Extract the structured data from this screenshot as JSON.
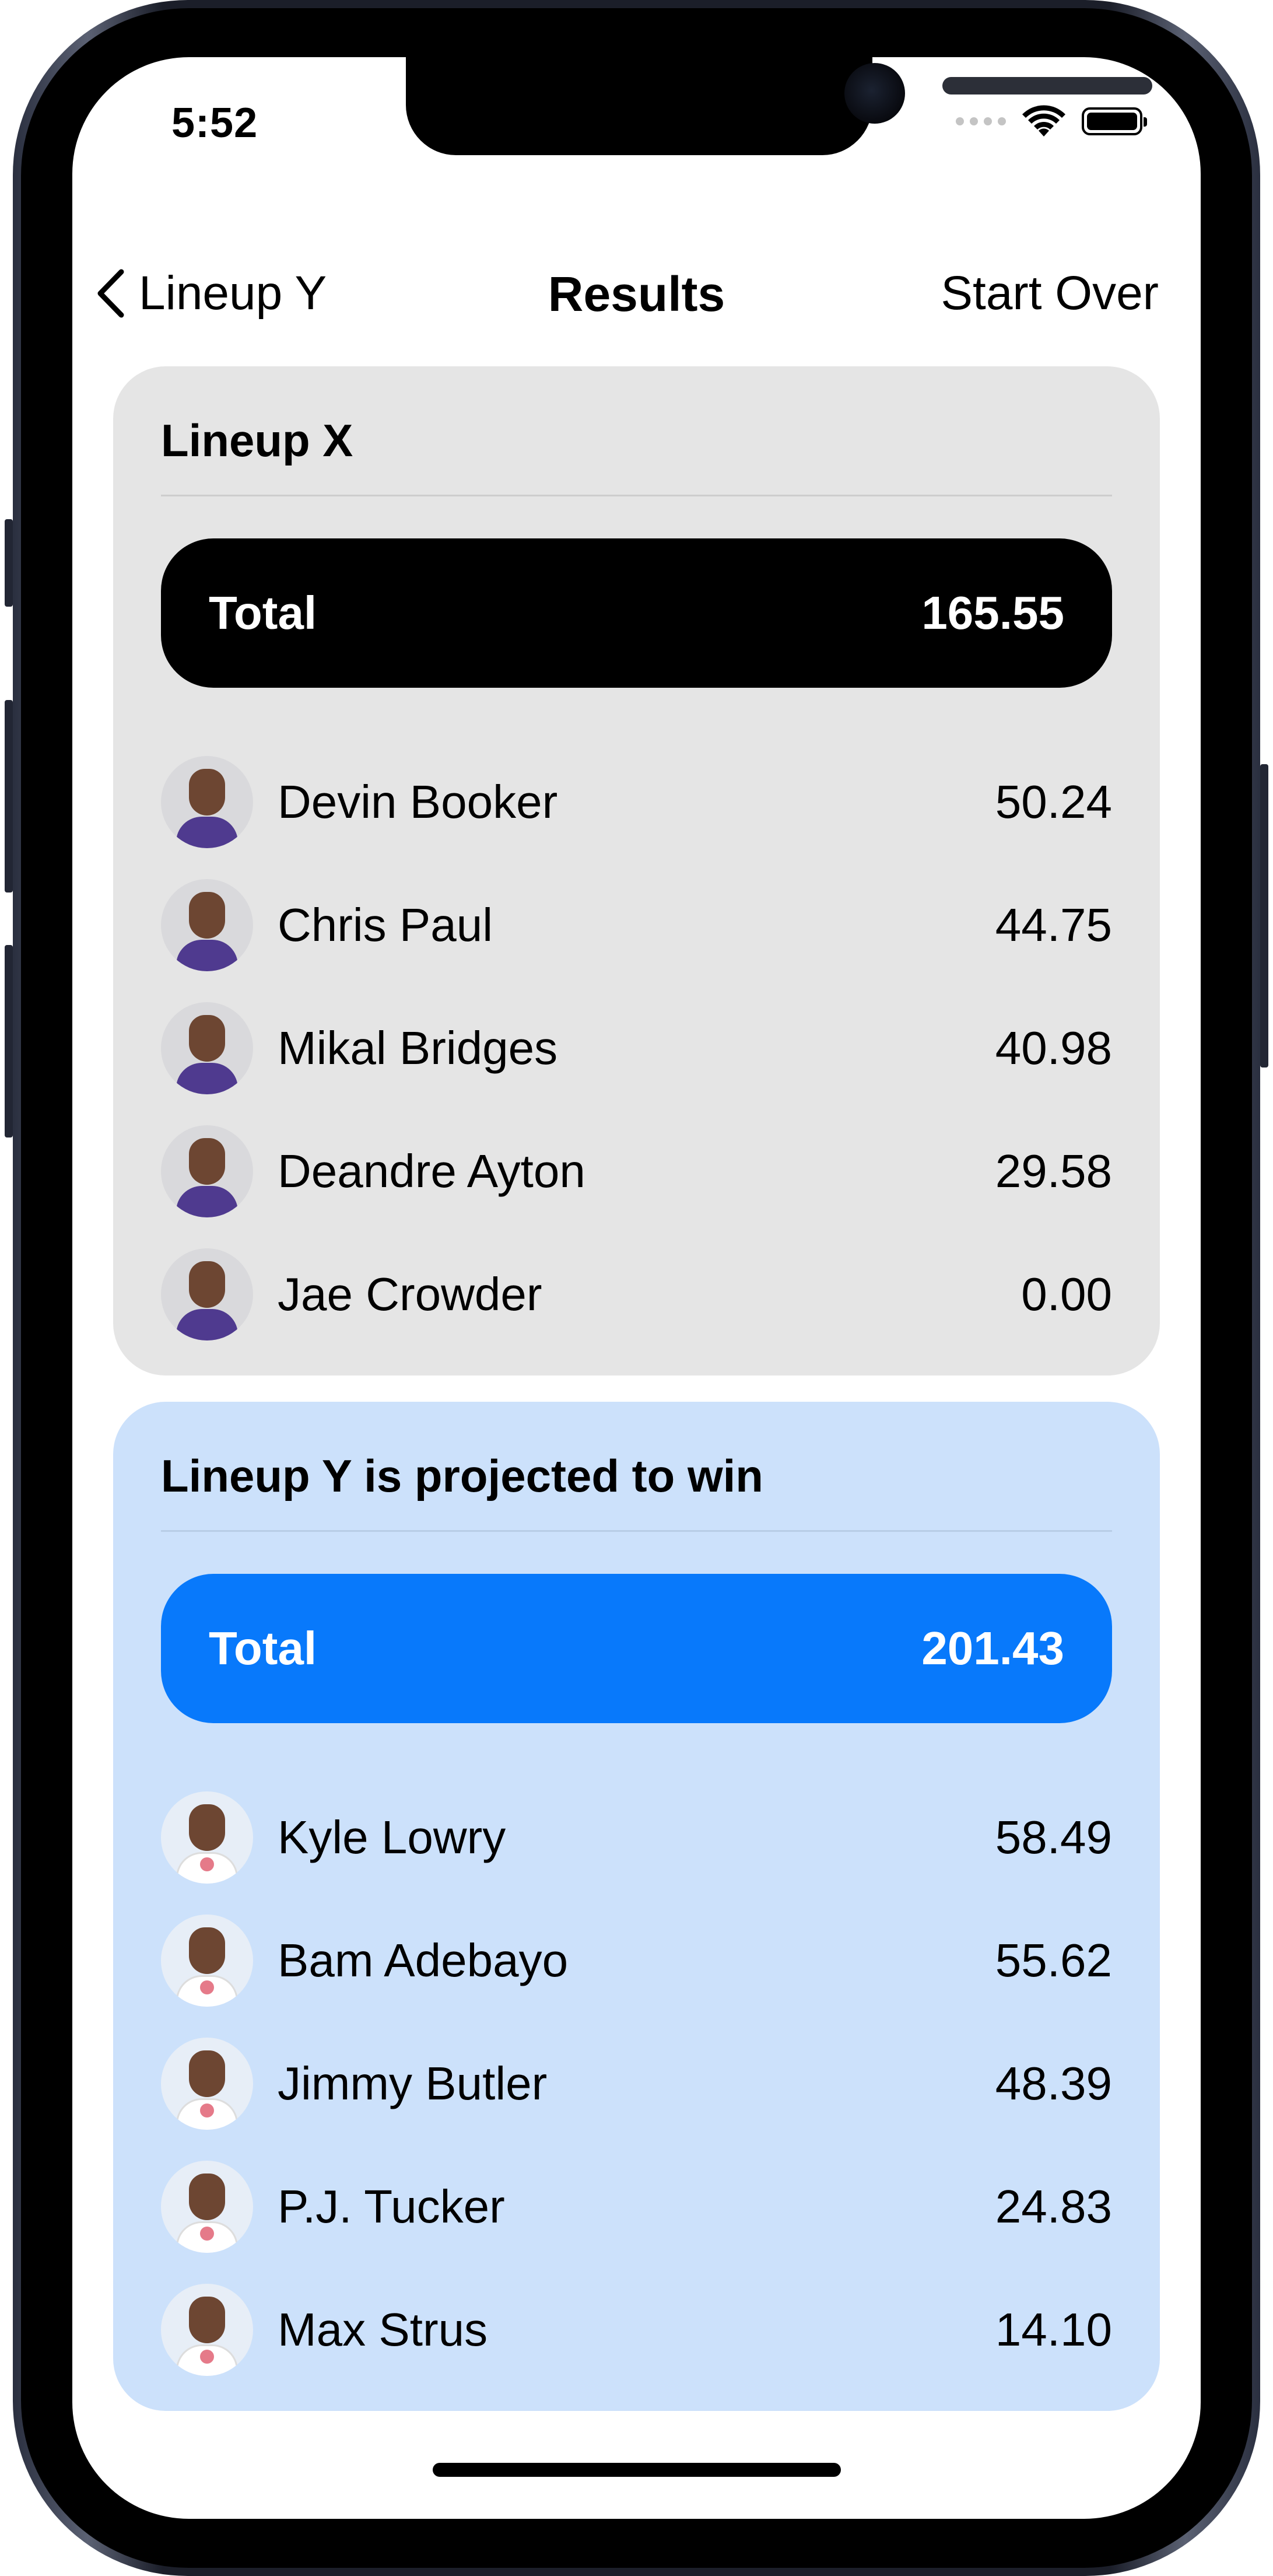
{
  "status_bar": {
    "time": "5:52",
    "icons": [
      "signal-dots-icon",
      "wifi-icon",
      "battery-icon"
    ]
  },
  "nav": {
    "back_label": "Lineup Y",
    "title": "Results",
    "right_label": "Start Over"
  },
  "lineup_x": {
    "title": "Lineup X",
    "total_label": "Total",
    "total_value": "165.55",
    "players": [
      {
        "name": "Devin Booker",
        "score": "50.24"
      },
      {
        "name": "Chris Paul",
        "score": "44.75"
      },
      {
        "name": "Mikal Bridges",
        "score": "40.98"
      },
      {
        "name": "Deandre Ayton",
        "score": "29.58"
      },
      {
        "name": "Jae Crowder",
        "score": "0.00"
      }
    ]
  },
  "lineup_y": {
    "title": "Lineup Y is projected to win",
    "total_label": "Total",
    "total_value": "201.43",
    "players": [
      {
        "name": "Kyle Lowry",
        "score": "58.49"
      },
      {
        "name": "Bam Adebayo",
        "score": "55.62"
      },
      {
        "name": "Jimmy Butler",
        "score": "48.39"
      },
      {
        "name": "P.J. Tucker",
        "score": "24.83"
      },
      {
        "name": "Max Strus",
        "score": "14.10"
      }
    ]
  },
  "colors": {
    "lineup_x_card": "#e5e5e5",
    "lineup_x_total": "#000000",
    "lineup_y_card": "#cce1fb",
    "lineup_y_total": "#0879fb"
  }
}
